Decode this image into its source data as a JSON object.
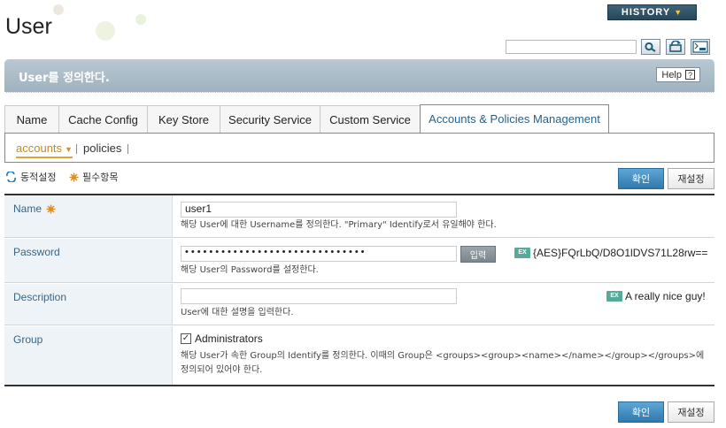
{
  "header": {
    "title": "User",
    "history_label": "HISTORY",
    "search_placeholder": ""
  },
  "banner": {
    "text": "User를 정의한다.",
    "help_label": "Help",
    "help_glyph": "?"
  },
  "tabs": [
    {
      "label": "Name"
    },
    {
      "label": "Cache Config"
    },
    {
      "label": "Key Store"
    },
    {
      "label": "Security Service"
    },
    {
      "label": "Custom Service"
    },
    {
      "label": "Accounts & Policies Management",
      "active": true
    }
  ],
  "subnav": [
    {
      "label": "accounts",
      "active": true
    },
    {
      "label": "policies"
    }
  ],
  "legend": {
    "dynamic": "동적설정",
    "required": "필수항목"
  },
  "buttons": {
    "confirm": "확인",
    "reset": "재설정"
  },
  "form": {
    "name": {
      "label": "Name",
      "value": "user1",
      "desc": "해당 User에 대한 Username를 정의한다. \"Primary\" Identify로서 유일해야 한다."
    },
    "password": {
      "label": "Password",
      "value": "••••••••••••••••••••••••••••••",
      "input_button": "입력",
      "example": "{AES}FQrLbQ/D8O1lDVS71L28rw==",
      "desc": "해당 User의 Password를 설정한다."
    },
    "description": {
      "label": "Description",
      "value": "",
      "example": "A really nice guy!",
      "desc": "User에 대한 설명을 입력한다."
    },
    "group": {
      "label": "Group",
      "checkbox_label": "Administrators",
      "checked": true,
      "desc_line1": "해당 User가 속한 Group의 Identify를 정의한다. 이때의 Group은 <groups><group><name></name></group></groups>에",
      "desc_line2": "정의되어 있어야 한다."
    }
  },
  "icons": {
    "history_arrow": "▼",
    "subnav_caret": "▼",
    "check_mark": "✓",
    "example_badge": "EX"
  },
  "colors": {
    "banner": "#a9bac6",
    "confirm_button": "#3f8cc2",
    "label_text": "#3a6585",
    "active_subnav": "#c98a1a",
    "required_icon": "#e08b1a",
    "dynamic_icon": "#2c7fc0"
  }
}
